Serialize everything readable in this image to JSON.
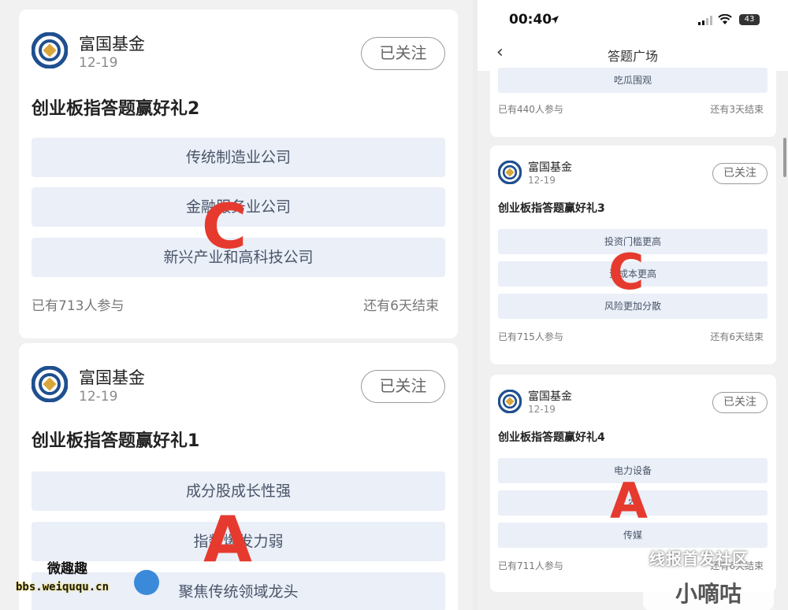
{
  "left_cards": [
    {
      "brand": "富国基金",
      "date": "12-19",
      "follow_label": "已关注",
      "title": "创业板指答题赢好礼2",
      "options": [
        "传统制造业公司",
        "金融服务业公司",
        "新兴产业和高科技公司"
      ],
      "participants": "已有713人参与",
      "remaining": "还有6天结束",
      "overlay_letter": "C"
    },
    {
      "brand": "富国基金",
      "date": "12-19",
      "follow_label": "已关注",
      "title": "创业板指答题赢好礼1",
      "options": [
        "成分股成长性强",
        "指数爆发力弱",
        "聚焦传统领域龙头"
      ],
      "overlay_letter": "A"
    }
  ],
  "phone": {
    "status": {
      "time": "00:40",
      "battery": "43"
    },
    "nav": {
      "back_icon": "chevron-left",
      "title": "答题广场"
    },
    "top_partial": {
      "option": "吃瓜围观",
      "participants": "已有440人参与",
      "remaining": "还有3天结束"
    },
    "cards": [
      {
        "brand": "富国基金",
        "date": "12-19",
        "follow_label": "已关注",
        "title": "创业板指答题赢好礼3",
        "options": [
          "投资门槛更高",
          "资成本更高",
          "风险更加分散"
        ],
        "participants": "已有715人参与",
        "remaining": "还有6天结束",
        "overlay_letter": "C"
      },
      {
        "brand": "富国基金",
        "date": "12-19",
        "follow_label": "已关注",
        "title": "创业板指答题赢好礼4",
        "options": [
          "电力设备",
          "农",
          "传媒"
        ],
        "participants": "已有711人参与",
        "remaining": "还有6天结束",
        "overlay_letter": "A"
      }
    ]
  },
  "watermarks": {
    "site_cn": "微趣趣",
    "site_url": "bbs.weiququ.cn",
    "right_text": "线报首发社区",
    "right_bottom": "小嘀咕"
  },
  "colors": {
    "accent_red": "#e63a2e",
    "option_bg": "#eaeff8",
    "logo_blue": "#1f4f8f",
    "logo_gold": "#d9a63c"
  }
}
